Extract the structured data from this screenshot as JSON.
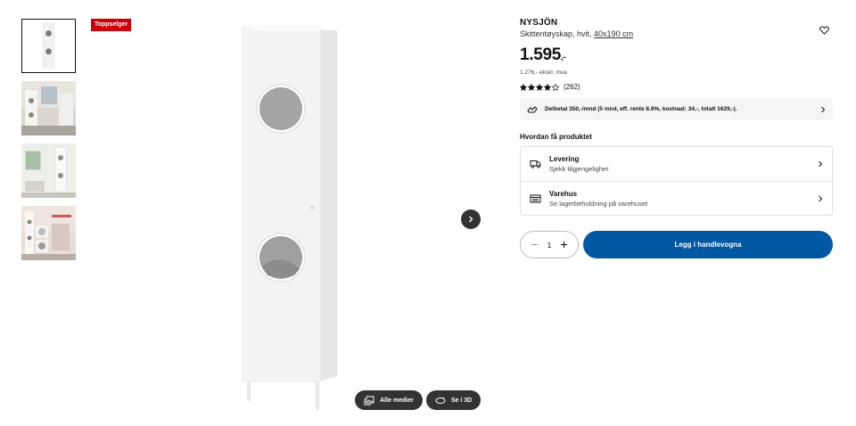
{
  "badge": "Toppselger",
  "gallery": {
    "thumbnails": [
      "cabinet-product",
      "bathroom-scene",
      "cabinet-window-scene",
      "laundry-room-scene"
    ]
  },
  "media_buttons": {
    "all_media": "Alle medier",
    "view_3d": "Se i 3D"
  },
  "product": {
    "name": "NYSJÖN",
    "description": "Skittentøyskap, hvit,",
    "size_link": "40x190 cm",
    "price_main": "1.595",
    "price_suffix": ",-",
    "price_ex_vat": "1.276,- ekskl. mva",
    "rating_stars": 4,
    "rating_max": 5,
    "review_count": "(262)"
  },
  "installment": {
    "text": "Delbetal 350,-/mnd (5 mnd, eff. rente 8.9%, kostnad: 34,-, totalt 1629,-)."
  },
  "how_to_get": {
    "title": "Hvordan få produktet",
    "options": [
      {
        "title": "Levering",
        "subtitle": "Sjekk tilgjengelighet",
        "icon": "truck-icon"
      },
      {
        "title": "Varehus",
        "subtitle": "Se lagerbeholdning på varehuset",
        "icon": "store-icon"
      }
    ]
  },
  "purchase": {
    "quantity": "1",
    "add_to_cart": "Legg i handlevogna"
  },
  "colors": {
    "accent_blue": "#0058a3",
    "badge_red": "#cc0008",
    "dark_button": "#333333"
  }
}
